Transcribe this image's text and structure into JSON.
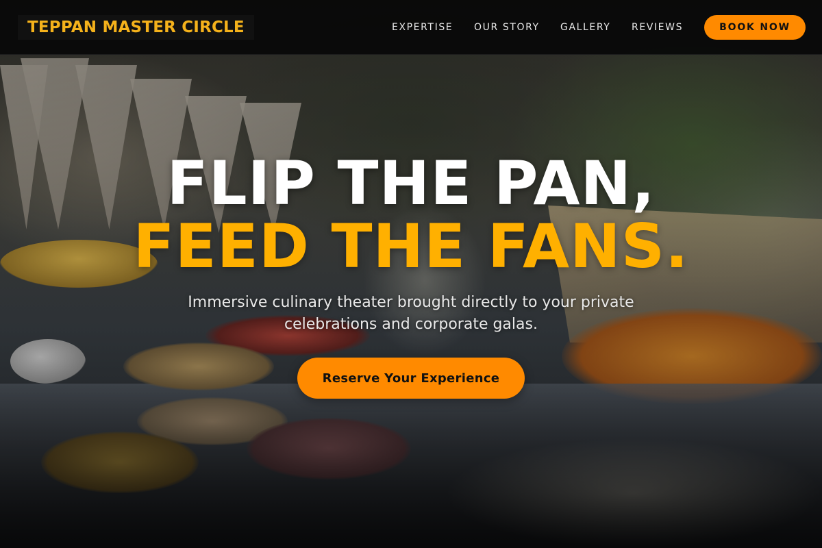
{
  "brand": {
    "name": "TEPPAN MASTER CIRCLE",
    "accent_color": "#ff8a00",
    "logo_color": "#f5b21b",
    "highlight_color": "#ffb000"
  },
  "nav": {
    "links": [
      {
        "label": "EXPERTISE"
      },
      {
        "label": "OUR STORY"
      },
      {
        "label": "GALLERY"
      },
      {
        "label": "REVIEWS"
      }
    ],
    "book_label": "BOOK NOW"
  },
  "hero": {
    "headline_line1": "FLIP THE PAN,",
    "headline_line2": "FEED THE FANS.",
    "subtitle": "Immersive culinary theater brought directly to your private celebrations and corporate galas.",
    "cta_label": "Reserve Your Experience"
  }
}
